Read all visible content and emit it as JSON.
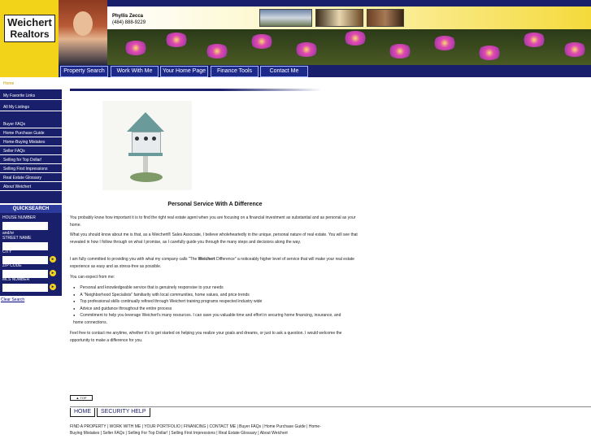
{
  "brand": {
    "logo_line1": "Weichert",
    "logo_line2": "Realtors",
    "primary_color": "#1a1f6b",
    "accent_color": "#f3d21a"
  },
  "agent": {
    "name": "Phyllis Zecca",
    "phone": "(484) 888-9229"
  },
  "nav": {
    "items": [
      "Property Search",
      "Work With Me",
      "Your Home Page",
      "Finance Tools",
      "Contact Me"
    ]
  },
  "sidebar": {
    "home": "Home",
    "items": [
      "My Favorite Links",
      "All My Listings",
      "Buyer FAQs",
      "Home Purchase Guide",
      "Home-Buying Mistakes",
      "Seller FAQs",
      "Selling for Top Dollar!",
      "Selling First Impressions",
      "Real Estate Glossary",
      "About Weichert"
    ]
  },
  "quick_search": {
    "title": "QUICKSEARCH",
    "house_number_label": "HOUSE NUMBER",
    "andor": "and/or",
    "street_label": "STREET NAME",
    "city_label": "CITY",
    "zip_label": "ZIP CODE",
    "mls_label": "MLS NUMBER",
    "go_icon": "go-arrow-icon",
    "clear": "Clear Search"
  },
  "main": {
    "title": "Personal Service With A Difference",
    "p1": "You probably know how important it is to find the right real estate agent when you are focusing on a financial investment as substantial and as personal as your home.",
    "p2": "What you should know about me is that, as a Weichert® Sales Associate, I believe wholeheartedly in the unique, personal nature of real estate. You will see that revealed in how I follow through on what I promise, as I carefully guide you through the many steps and decisions along the way.",
    "p3a": "I am fully committed to providing you with what my company calls \"The ",
    "p3b": "Weichert",
    "p3c": " Difference\" a noticeably higher level of service that will make your real estate experience as easy and as stress-free as possible.",
    "p4": "You can expect from me:",
    "bullets": [
      "Personal and knowledgeable service that is genuinely responsive to your needs",
      "A \"Neighborhood Specialists\" familiarity with local communities, home values, and price trends",
      "Top professional skills continually refined through Weichert training programs respected industry wide",
      "Advice and guidance throughout the entire process",
      "Commitment to help you leverage Weichert's many resources. I can save you valuable time and effort in securing home financing, insurance, and home connections."
    ],
    "p5": "Feel free to contact me anytime, whether it's to get started on helping you realize your goals and dreams, or just to ask a question. I would welcome the opportunity to make a difference for you."
  },
  "footer": {
    "top": "TOP",
    "tabs": [
      "HOME",
      "SECURITY HELP"
    ],
    "links": "FIND A PROPERTY | WORK WITH ME | YOUR PORTFOLIO | FINANCING | CONTACT ME | Buyer FAQs | Home Purchase Guide | Home-Buying Mistakes | Seller FAQs | Selling For Top Dollar! | Selling First Impressions | Real Estate Glossary | About Weichert"
  }
}
